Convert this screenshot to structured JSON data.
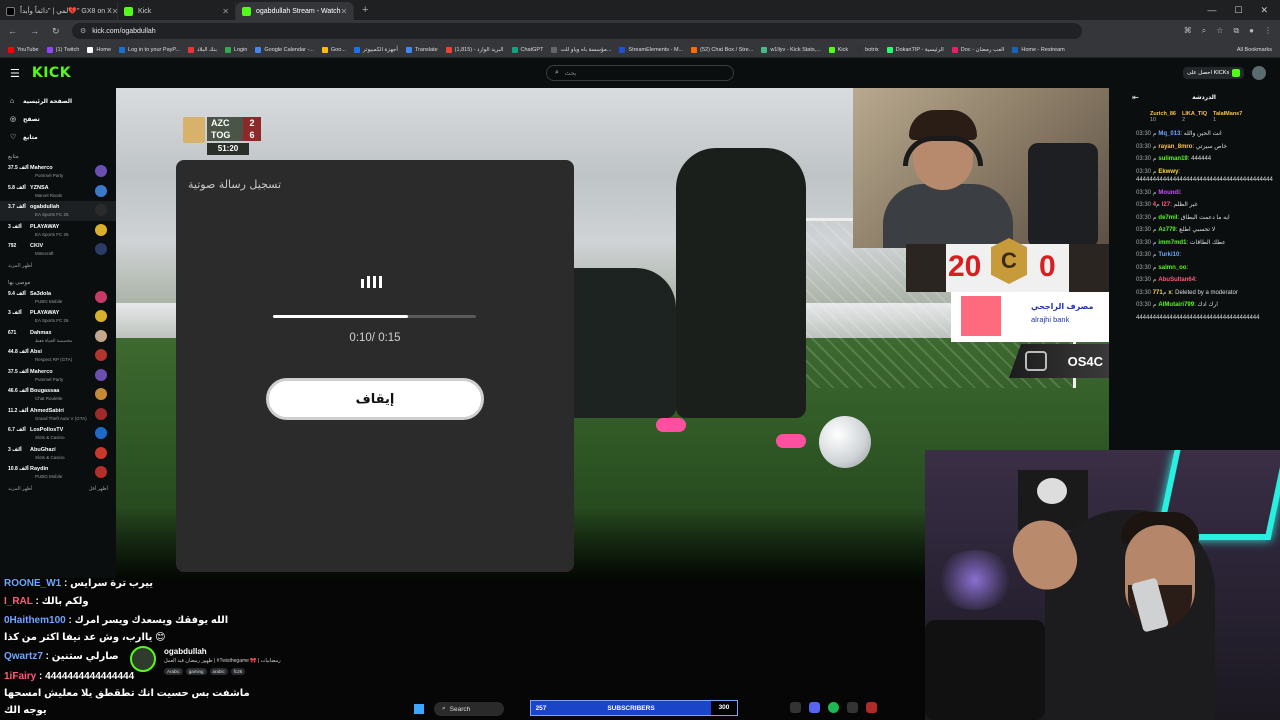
{
  "browser": {
    "tabs": [
      {
        "title": "لمي | \"دائماً وأبداً💔\" GX8 on X",
        "color": "#ffffff",
        "active": false
      },
      {
        "title": "Kick",
        "color": "#53fc18",
        "active": false
      },
      {
        "title": "ogabdullah Stream - Watch",
        "color": "#53fc18",
        "active": true
      }
    ],
    "url": "kick.com/ogabdullah",
    "bookmarks": [
      "YouTube",
      "(1) Twitch",
      "Home",
      "Log in to your PayP...",
      "بنك البلاد",
      "Login",
      "Google Calendar -...",
      "Goo...",
      "أجهزة الكمبيوتر",
      "Translate",
      "البريد الوارد - (1,815)",
      "ChatGPT",
      "مؤسسة باه وياو للت...",
      "StreamElements - M...",
      "(52) Chat Box / Stre...",
      "w1llyv - Kick Stats,...",
      "Kick",
      "botrix",
      "DokanTIP - الرئيسية",
      "Doc - العب رمضان",
      "Home - Restream"
    ],
    "all_bookmarks": "All Bookmarks"
  },
  "kick": {
    "logo": "KICK",
    "search_placeholder": "بحث",
    "get_kicks": "احصل على KICKs"
  },
  "sidebar": {
    "nav": [
      {
        "label": "الصفحة الرئيسية",
        "icon": "home-icon"
      },
      {
        "label": "تصفح",
        "icon": "browse-icon"
      },
      {
        "label": "متابع",
        "icon": "heart-icon"
      }
    ],
    "section1": "متابع",
    "followed": [
      {
        "count": "37.5 ألف",
        "name": "Maherco",
        "category": "Pummel Party",
        "color": "#6b4fb3"
      },
      {
        "count": "5.8 ألف",
        "name": "YZNSA",
        "category": "Marvel Rivals",
        "color": "#3b78c9"
      },
      {
        "count": "3.7 ألف",
        "name": "ogabdullah",
        "category": "EA Sports FC 26",
        "color": "#2b2b2b"
      },
      {
        "count": "3 ألف",
        "name": "PLAYAWAY",
        "category": "EA Sports FC 26",
        "color": "#d8b02a"
      },
      {
        "count": "792",
        "name": "CKIV",
        "category": "Minecraft",
        "color": "#2a3c66"
      }
    ],
    "show_more1": "أظهر المزيد",
    "section2": "موصى بها",
    "recommended": [
      {
        "count": "9.4 ألف",
        "name": "Sa3dola",
        "category": "PUBG Mobile",
        "color": "#c43b66"
      },
      {
        "count": "3 ألف",
        "name": "PLAYAWAY",
        "category": "EA Sports FC 26",
        "color": "#d8b02a"
      },
      {
        "count": "671",
        "name": "Dahmax",
        "category": "مخصصة الحياة فقط",
        "color": "#c4a88d"
      },
      {
        "count": "44.8 ألف",
        "name": "Absi",
        "category": "Respect RP (GTA)",
        "color": "#b1342f"
      },
      {
        "count": "37.5 ألف",
        "name": "Maherco",
        "category": "Pummel Party",
        "color": "#6b4fb3"
      },
      {
        "count": "46.6 ألف",
        "name": "Bougassaa",
        "category": "Chat Roulette",
        "color": "#c78a36"
      },
      {
        "count": "11.2 ألف",
        "name": "AhmedSabiri",
        "category": "Grand Theft Auto V (GTA)",
        "color": "#9e2a2a"
      },
      {
        "count": "6.7 ألف",
        "name": "LosPollosTV",
        "category": "Slots & Casino",
        "color": "#1f6ac9"
      },
      {
        "count": "3 ألف",
        "name": "AbuGhazi",
        "category": "Slots & Casino",
        "color": "#c8382c"
      },
      {
        "count": "10.8 ألف",
        "name": "Raydin",
        "category": "PUBG Mobile",
        "color": "#b42f2a"
      }
    ],
    "show_more2": "أظهر المزيد",
    "show_less": "أظهر أقل"
  },
  "scoreboard": {
    "team1": "AZC",
    "score1": "2",
    "team2": "TOG",
    "score2": "6",
    "time": "51:20"
  },
  "dialog": {
    "title": "تسجيل رسالة صوتية",
    "progress": 0.667,
    "time_current": "0:10",
    "time_total": "0:15",
    "time_display": "0:10/ 0:15",
    "stop_label": "إيقاف"
  },
  "overlay": {
    "score_left": "20",
    "score_right": "0",
    "badge": "C",
    "bank_ar": "مصرف الراجحي",
    "bank_en": "alrajhi bank",
    "sponsor": "OS4C",
    "subscribers_label": "SUBSCRIBERS",
    "subscribers_current": "257",
    "subscribers_goal": "300"
  },
  "bottom_chat": [
    {
      "user": "ROONE_W1",
      "text": "ييرب ترة سرايس"
    },
    {
      "user": "I_RAL",
      "text": "ولكم بالك"
    },
    {
      "user": "0Haithem100",
      "text": "الله يوفقك ويسعدك ويسر امرك"
    },
    {
      "user": "",
      "text": "ياارب، وش عد نيفا اكثر من كذا 😊"
    },
    {
      "user": "Qwartz7",
      "text": "صارلي ستنين"
    },
    {
      "user": "1iFairy",
      "text": "4444444444444444"
    },
    {
      "user": "",
      "text": "ماشفت بس حسيت انك تطقطق يلا معليش امسحها"
    },
    {
      "user": "",
      "text": "يوجه الك"
    }
  ],
  "stream_info": {
    "name": "ogabdullah",
    "title": "ظهور رمضان قيد العمل | #Twisthegame 🎀 | رمضانيات",
    "category": "EA Sports FC 26",
    "tags": [
      "Arabic",
      "gaming",
      "arabic",
      "fc26"
    ]
  },
  "taskbar": {
    "search": "Search"
  },
  "chat": {
    "title": "الدردشة",
    "leaderboard": [
      {
        "user": "Zurich_86",
        "value": "10"
      },
      {
        "user": "LIKA_TIQ",
        "value": "2"
      },
      {
        "user": "TalalMans7",
        "value": "1"
      }
    ],
    "messages": [
      {
        "time": "03:30 م",
        "user": "Mq_013",
        "color": "#6fa6ff",
        "text": "انت الحين والله"
      },
      {
        "time": "03:30 م",
        "user": "rayan_8mro",
        "color": "#ffc24d",
        "text": "خاص سيرتي"
      },
      {
        "time": "03:30 م",
        "user": "suliman19",
        "color": "#53fc18",
        "text": "444444"
      },
      {
        "time": "03:30 م",
        "user": "Ekwwy",
        "color": "#ffd84d",
        "text": "44444444444444444444444444444444444444444"
      },
      {
        "time": "03:30 م",
        "user": "Moundi",
        "color": "#c84dff",
        "text": ""
      },
      {
        "time": "03:30 م",
        "user": "4I27",
        "color": "#ff5c7a",
        "text": "غير الظلم"
      },
      {
        "time": "03:30 م",
        "user": "de7mil",
        "color": "#53fc18",
        "text": "ايه ما دعمت البطاق"
      },
      {
        "time": "03:30 م",
        "user": "Az779",
        "color": "#53fc18",
        "text": "لا تحسبي اطلع"
      },
      {
        "time": "03:30 م",
        "user": "imm7md1",
        "color": "#53fc18",
        "text": "عطك الطاقات"
      },
      {
        "time": "03:30 م",
        "user": "Turki10",
        "color": "#6fa6ff",
        "text": ""
      },
      {
        "time": "03:30 م",
        "user": "salmn_oo",
        "color": "#53fc18",
        "text": ""
      },
      {
        "time": "03:30 م",
        "user": "AbuSultan64",
        "color": "#ff5c7a",
        "text": ""
      },
      {
        "time": "03:30 م",
        "user": "771x",
        "color": "#ffd84d",
        "text": "Deleted by a moderator"
      },
      {
        "time": "03:30 م",
        "user": "AlMutairi799",
        "color": "#53fc18",
        "text": "ارك ادك"
      },
      {
        "time": "",
        "user": "",
        "color": "#ffffff",
        "text": "4444444444444444444444444444444444444"
      }
    ]
  },
  "colors": {
    "kick_green": "#53fc18",
    "bg": "#0b0e0f",
    "dialog_bg": "#2b2b2b"
  }
}
